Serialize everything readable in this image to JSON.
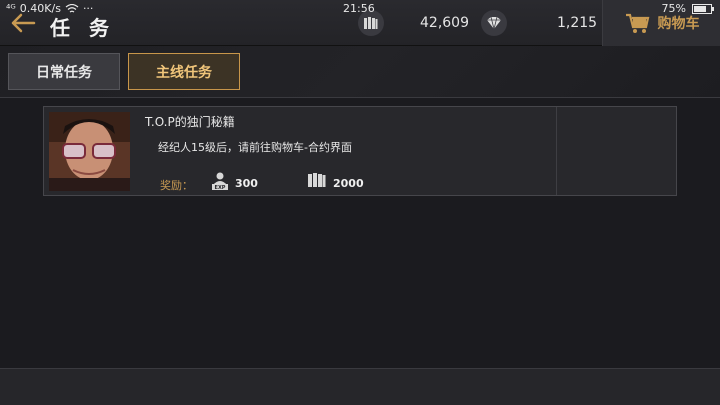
{
  "status_bar": {
    "signal": "⁴ᴳ",
    "network_speed": "0.40K/s",
    "extra": "···",
    "time": "21:56",
    "battery_percent": "75%",
    "battery_level": 0.75
  },
  "header": {
    "title": "任 务",
    "currencies": [
      {
        "icon": "books-icon",
        "value": "42,609"
      },
      {
        "icon": "diamond-icon",
        "value": "1,215"
      }
    ],
    "shop_label": "购物车"
  },
  "tabs": [
    {
      "label": "日常任务",
      "active": false
    },
    {
      "label": "主线任务",
      "active": true
    }
  ],
  "tasks": [
    {
      "title": "T.O.P的独门秘籍",
      "description": "经纪人15级后，请前往购物车-合约界面",
      "reward_label": "奖励：",
      "rewards": [
        {
          "icon": "exp-icon",
          "value": "300"
        },
        {
          "icon": "books-icon",
          "value": "2000"
        }
      ]
    }
  ],
  "colors": {
    "accent_gold": "#c89a52",
    "background": "#1c1c20"
  }
}
